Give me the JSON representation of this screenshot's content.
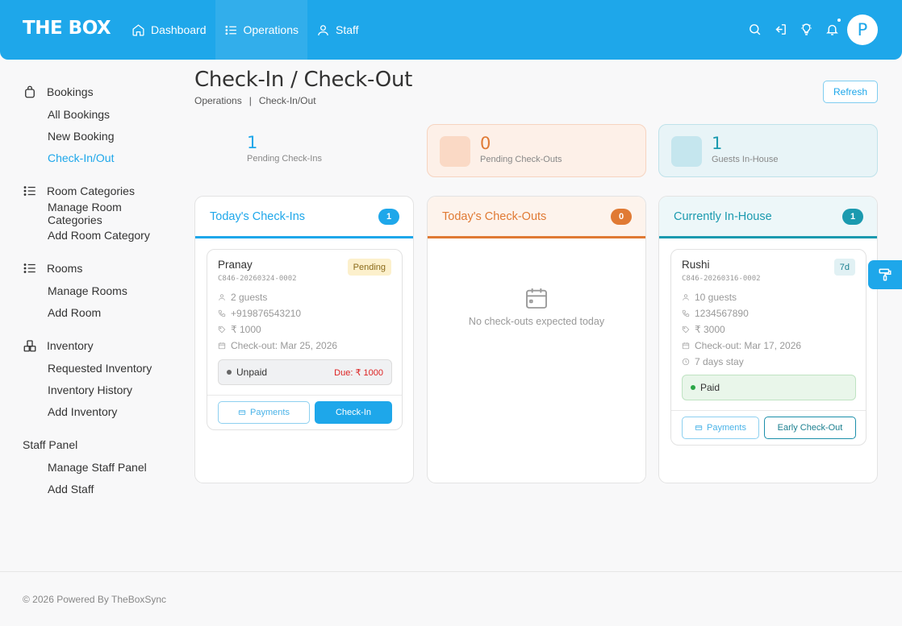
{
  "header": {
    "brand": "THE BOX",
    "nav": [
      {
        "label": "Dashboard",
        "icon": "home-icon"
      },
      {
        "label": "Operations",
        "icon": "list-icon",
        "active": true
      },
      {
        "label": "Staff",
        "icon": "user-icon"
      }
    ],
    "icons": [
      "search-icon",
      "login-icon",
      "bulb-icon",
      "bell-icon"
    ],
    "avatar_initial": "P"
  },
  "sidebar": {
    "groups": [
      {
        "title": "Bookings",
        "icon": "bag-icon",
        "items": [
          "All Bookings",
          "New Booking",
          "Check-In/Out"
        ]
      },
      {
        "title": "Room Categories",
        "icon": "list-icon",
        "items": [
          "Manage Room Categories",
          "Add Room Category"
        ]
      },
      {
        "title": "Rooms",
        "icon": "list-icon",
        "items": [
          "Manage Rooms",
          "Add Room"
        ]
      },
      {
        "title": "Inventory",
        "icon": "boxes-icon",
        "items": [
          "Requested Inventory",
          "Inventory History",
          "Add Inventory"
        ]
      },
      {
        "title": "Staff Panel",
        "icon": "",
        "items": [
          "Manage Staff Panel",
          "Add Staff"
        ]
      }
    ],
    "active_item": "Check-In/Out"
  },
  "page": {
    "title": "Check-In / Check-Out",
    "breadcrumb": [
      "Operations",
      "|",
      "Check-In/Out"
    ],
    "refresh_label": "Refresh"
  },
  "stats": [
    {
      "value": "1",
      "label": "Pending Check-Ins"
    },
    {
      "value": "0",
      "label": "Pending Check-Outs"
    },
    {
      "value": "1",
      "label": "Guests In-House"
    }
  ],
  "checkins": {
    "title": "Today's Check-Ins",
    "count": "1",
    "card": {
      "name": "Pranay",
      "code": "C846-20260324-0002",
      "status": "Pending",
      "guests": "2 guests",
      "phone": "+919876543210",
      "amount": "₹ 1000",
      "checkout": "Check-out: Mar 25, 2026",
      "payment_status": "Unpaid",
      "due": "Due: ₹ 1000",
      "payments_label": "Payments",
      "action_label": "Check-In"
    }
  },
  "checkouts": {
    "title": "Today's Check-Outs",
    "count": "0",
    "empty_text": "No check-outs expected today"
  },
  "inhouse": {
    "title": "Currently In-House",
    "count": "1",
    "card": {
      "name": "Rushi",
      "code": "C846-20260316-0002",
      "status": "7d",
      "guests": "10 guests",
      "phone": "1234567890",
      "amount": "₹ 3000",
      "checkout": "Check-out: Mar 17, 2026",
      "stay": "7 days stay",
      "payment_status": "Paid",
      "payments_label": "Payments",
      "action_label": "Early Check-Out"
    }
  },
  "footer": {
    "text": "© 2026 Powered By TheBoxSync"
  },
  "colors": {
    "primary": "#1ea7ea",
    "orange": "#e07a34",
    "teal": "#1b9aaf",
    "danger": "#dd2222",
    "success": "#2aa546"
  }
}
